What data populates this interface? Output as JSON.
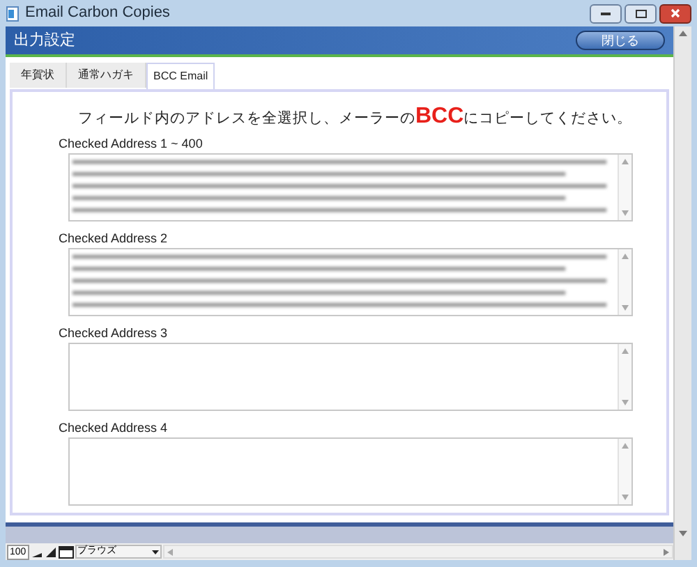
{
  "window": {
    "title": "Email Carbon Copies"
  },
  "header": {
    "title": "出力設定",
    "close_button": "閉じる"
  },
  "tabs": [
    {
      "label": "年賀状",
      "selected": false
    },
    {
      "label": "通常ハガキ",
      "selected": false
    },
    {
      "label": "BCC Email",
      "selected": true
    }
  ],
  "instruction": "フィールド内のアドレスを全選択し、メーラーの**BCC**にコピーしてください。",
  "fields": [
    {
      "label": "Checked Address 1 ~ 400",
      "kind": "blurred"
    },
    {
      "label": "Checked Address 2",
      "kind": "blurred"
    },
    {
      "label": "Checked Address 3",
      "kind": "empty"
    },
    {
      "label": "Checked Address 4",
      "kind": "empty"
    }
  ],
  "status_bar": {
    "zoom": "100",
    "mode": "ブラウズ"
  }
}
